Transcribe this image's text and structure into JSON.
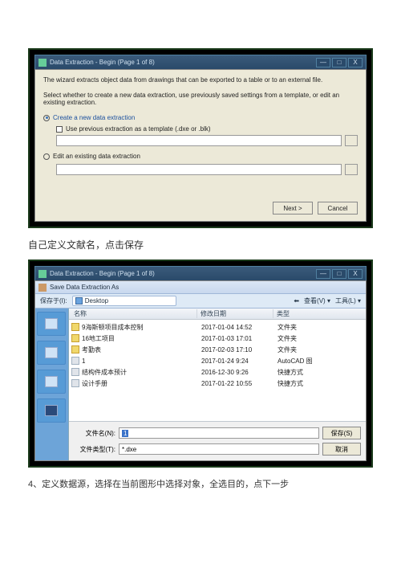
{
  "dlg1": {
    "title": "Data Extraction - Begin (Page 1 of 8)",
    "intro": "The wizard extracts object data from drawings that can be exported to a table or to an external file.",
    "subtitle": "Select whether to create a new data extraction, use previously saved settings from a template, or edit an existing extraction.",
    "opt1": "Create a new data extraction",
    "chk1": "Use previous extraction as a template (.dxe or .blk)",
    "opt2": "Edit an existing data extraction",
    "next": "Next >",
    "cancel": "Cancel"
  },
  "cap1": "自己定义文献名，点击保存",
  "save": {
    "titlebar": "Data Extraction - Begin (Page 1 of 8)",
    "inner_title": "Save Data Extraction As",
    "save_in": "保存于(I):",
    "location": "Desktop",
    "view": "查看(V)",
    "tools": "工具(L)",
    "col_name": "名称",
    "col_date": "修改日期",
    "col_type": "类型",
    "files": [
      {
        "n": "9海斯顿项目成本控制",
        "d": "2017-01-04 14:52",
        "t": "文件夹",
        "f": true
      },
      {
        "n": "16地工项目",
        "d": "2017-01-03 17:01",
        "t": "文件夹",
        "f": true
      },
      {
        "n": "考勤表",
        "d": "2017-02-03 17:10",
        "t": "文件夹",
        "f": true
      },
      {
        "n": "1",
        "d": "2017-01-24 9:24",
        "t": "AutoCAD 图",
        "f": false
      },
      {
        "n": "结构件成本预计",
        "d": "2016-12-30 9:26",
        "t": "快捷方式",
        "f": false
      },
      {
        "n": "设计手册",
        "d": "2017-01-22 10:55",
        "t": "快捷方式",
        "f": false
      }
    ],
    "fname_label": "文件名(N):",
    "fname_value": "1",
    "ftype_label": "文件类型(T):",
    "ftype_value": "*.dxe",
    "save_btn": "保存(S)",
    "cancel_btn": "取消"
  },
  "cap2": "4、定义数据源，选择在当前图形中选择对象，全选目的，点下一步"
}
